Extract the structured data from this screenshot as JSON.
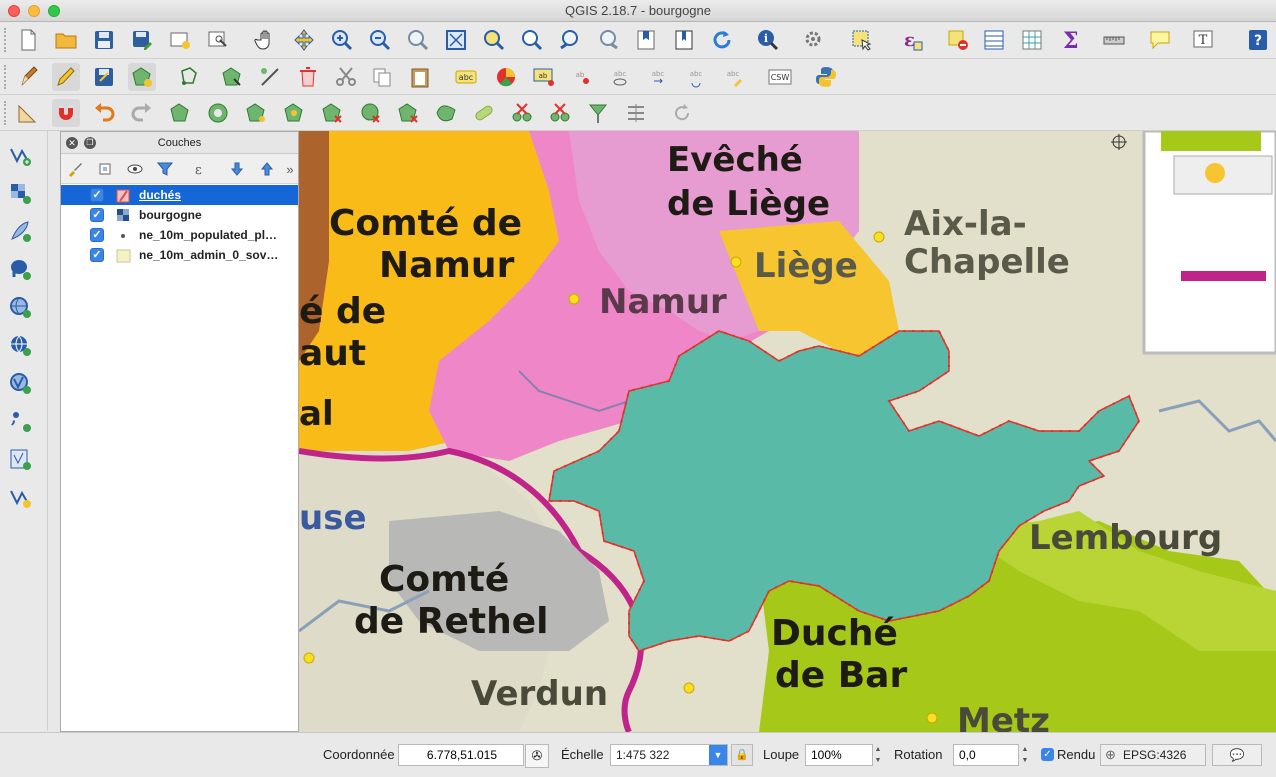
{
  "window": {
    "title": "QGIS 2.18.7 - bourgogne"
  },
  "layers_panel": {
    "title": "Couches",
    "layers": [
      {
        "name": "duchés",
        "checked": true,
        "selected": true
      },
      {
        "name": "bourgogne",
        "checked": true,
        "selected": false
      },
      {
        "name": "ne_10m_populated_pl…",
        "checked": true,
        "selected": false
      },
      {
        "name": "ne_10m_admin_0_sov…",
        "checked": true,
        "selected": false
      }
    ]
  },
  "map": {
    "labels": {
      "eveche1": "Evêché",
      "eveche2": "de Liège",
      "aix1": "Aix-la-",
      "aix2": "Chapelle",
      "liege": "Liège",
      "comte1": "Comté de",
      "comte2": "Namur",
      "namur": "Namur",
      "hainaut1": "é de",
      "hainaut2": "aut",
      "hainaut3": "al",
      "meuse": "use",
      "rethel1": "Comté",
      "rethel2": "de Rethel",
      "lux": "Lembourg",
      "bar1": "Duché",
      "bar2": "de Bar",
      "verdun": "Verdun",
      "metz": "Metz"
    }
  },
  "status": {
    "coord_label": "Coordonnée",
    "coord_value": "6.778,51.015",
    "scale_label": "Échelle",
    "scale_value": "1:475 322",
    "zoom_label": "Loupe",
    "zoom_value": "100%",
    "rotation_label": "Rotation",
    "rotation_value": "0,0",
    "render_label": "Rendu",
    "crs": "EPSG:4326"
  }
}
